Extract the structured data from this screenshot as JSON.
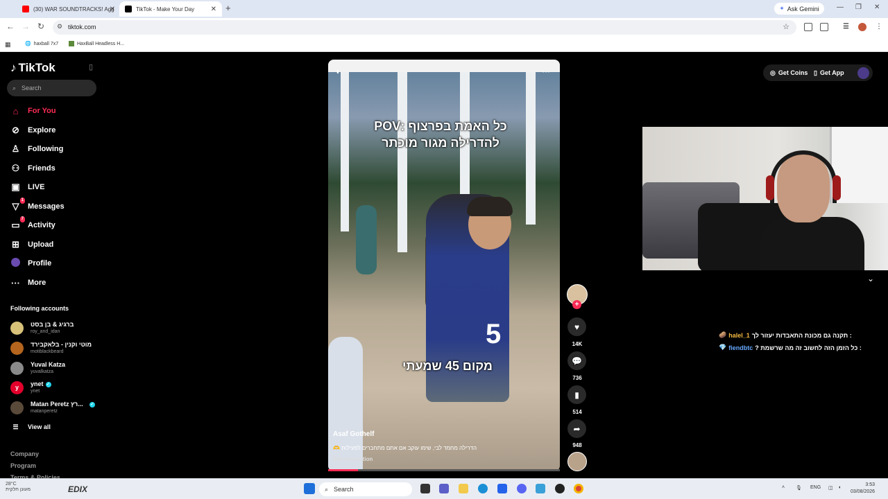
{
  "browser": {
    "tabs": [
      {
        "label": "(30) WAR SOUNDTRACKS! Agg",
        "active": false
      },
      {
        "label": "TikTok - Make Your Day",
        "active": true
      }
    ],
    "ask_gemini": "Ask Gemini",
    "url": "tiktok.com",
    "bookmarks": [
      "haxball 7x7",
      "HaxBall Headless H..."
    ]
  },
  "tiktok": {
    "logo": "TikTok",
    "search_placeholder": "Search",
    "nav": [
      {
        "label": "For You",
        "icon": "home-icon"
      },
      {
        "label": "Explore",
        "icon": "compass-icon"
      },
      {
        "label": "Following",
        "icon": "user-follow-icon"
      },
      {
        "label": "Friends",
        "icon": "friends-icon"
      },
      {
        "label": "LIVE",
        "icon": "live-tv-icon"
      },
      {
        "label": "Messages",
        "icon": "send-icon",
        "badge": "1"
      },
      {
        "label": "Activity",
        "icon": "activity-icon",
        "badge": "7"
      },
      {
        "label": "Upload",
        "icon": "upload-icon"
      },
      {
        "label": "Profile",
        "icon": "profile-icon"
      },
      {
        "label": "More",
        "icon": "more-icon"
      }
    ],
    "following_title": "Following accounts",
    "accounts": [
      {
        "name": "ברגיג & בן בסט",
        "handle": "roy_and_idan",
        "verified": false
      },
      {
        "name": "מוטי וקנין - בלאקבירד",
        "handle": "motiblackbeard",
        "verified": false
      },
      {
        "name": "Yuval Katza",
        "handle": "yuvalkatza",
        "verified": false
      },
      {
        "name": "ynet",
        "handle": "ynet",
        "verified": true
      },
      {
        "name": "Matan Peretz רץ...",
        "handle": "matanperetz",
        "verified": true
      }
    ],
    "view_all": "View all",
    "footer": [
      "Company",
      "Program",
      "Terms & Policies"
    ],
    "top_right": {
      "get_coins": "Get Coins",
      "get_app": "Get App"
    }
  },
  "video": {
    "caption_top": "כל האמת בפרצוף :POV להדרילה מגור מוכתר",
    "caption_mid": "מקום 45 שמעתי",
    "author": "Asaf Gothelf",
    "description": "הדרילה מחמד לבי, שימו עוקב אם אתם מתחברים לפעילות 🫶",
    "see_translation": "See translation",
    "progress": 0.13,
    "likes": "14K",
    "comments": "736",
    "saves": "514",
    "shares": "948"
  },
  "chat": [
    {
      "user": "halel_1",
      "text": ": תקנה גם מכונת התאבדות יעזור לך",
      "color": "#f5b942"
    },
    {
      "user": "fiendbtc",
      "text": ": כל הזמן הזה לחשוב זה מה שרשמת ?",
      "color": "#66a8ff"
    }
  ],
  "taskbar": {
    "weather_temp": "28°C",
    "weather_desc": "מעונן חלקית",
    "edix": "EDIX",
    "search": "Search",
    "lang": "ENG",
    "time": "3:53",
    "date": "03/08/2026"
  }
}
